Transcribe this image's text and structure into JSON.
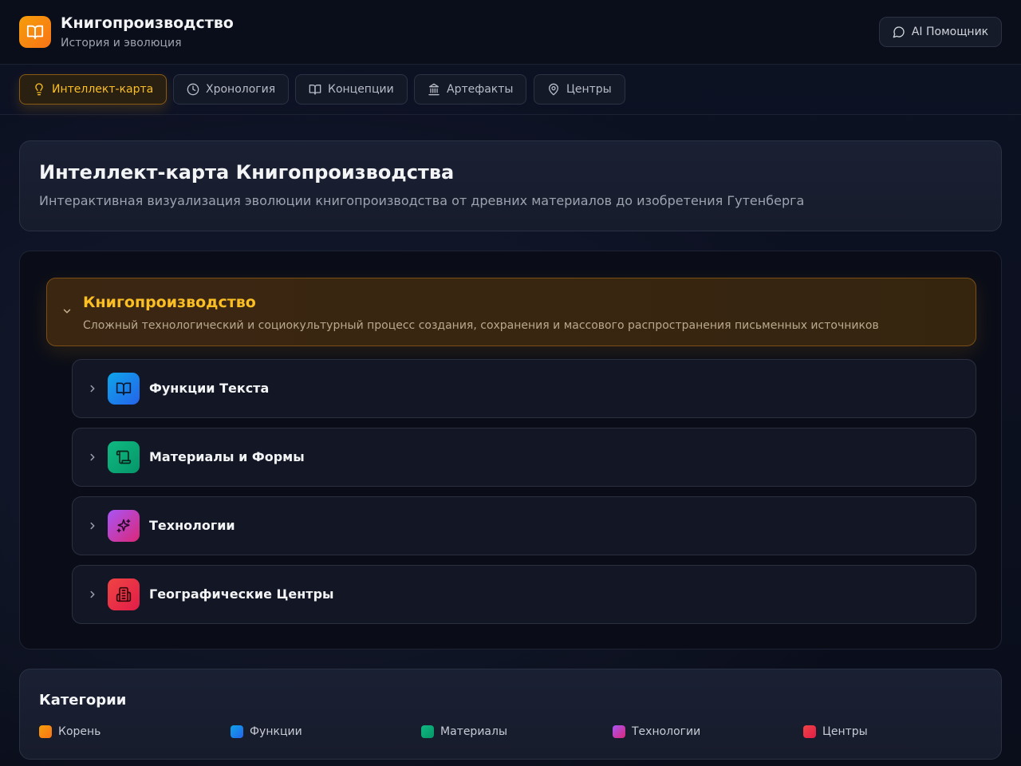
{
  "header": {
    "title": "Книгопроизводство",
    "subtitle": "История и эволюция",
    "ai_button": "AI Помощник"
  },
  "tabs": [
    {
      "label": "Интеллект-карта",
      "icon": "lightbulb-icon",
      "active": true
    },
    {
      "label": "Хронология",
      "icon": "clock-icon",
      "active": false
    },
    {
      "label": "Концепции",
      "icon": "book-open-icon",
      "active": false
    },
    {
      "label": "Артефакты",
      "icon": "landmark-icon",
      "active": false
    },
    {
      "label": "Центры",
      "icon": "map-pin-icon",
      "active": false
    }
  ],
  "hero": {
    "title": "Интеллект-карта Книгопроизводства",
    "description": "Интерактивная визуализация эволюции книгопроизводства от древних материалов до изобретения Гутенберга"
  },
  "mindmap": {
    "root": {
      "title": "Книгопроизводство",
      "description": "Сложный технологический и социокультурный процесс создания, сохранения и массового распространения письменных источников",
      "expanded": true
    },
    "children": [
      {
        "label": "Функции Текста",
        "icon": "book-open-icon",
        "color": "#0ea5e9"
      },
      {
        "label": "Материалы и Формы",
        "icon": "scroll-icon",
        "color": "#10b981"
      },
      {
        "label": "Технологии",
        "icon": "sparkles-icon",
        "color": "#c026d3"
      },
      {
        "label": "Географические Центры",
        "icon": "building-icon",
        "color": "#ef4444"
      }
    ]
  },
  "categories": {
    "title": "Категории",
    "items": [
      {
        "label": "Корень",
        "color": "#f97316"
      },
      {
        "label": "Функции",
        "color": "#0ea5e9"
      },
      {
        "label": "Материалы",
        "color": "#10b981"
      },
      {
        "label": "Технологии",
        "color": "#c026d3"
      },
      {
        "label": "Центры",
        "color": "#ef4444"
      }
    ]
  }
}
